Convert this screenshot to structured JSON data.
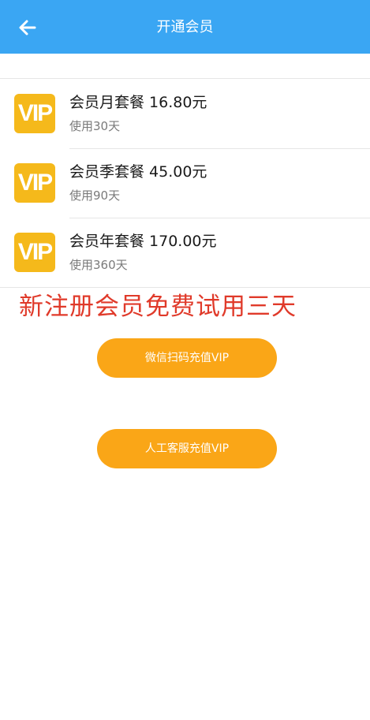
{
  "header": {
    "title": "开通会员",
    "back_icon": "arrow-left-icon"
  },
  "plans": [
    {
      "badge": "VIP",
      "title": "会员月套餐 16.80元",
      "duration": "使用30天"
    },
    {
      "badge": "VIP",
      "title": "会员季套餐 45.00元",
      "duration": "使用90天"
    },
    {
      "badge": "VIP",
      "title": "会员年套餐 170.00元",
      "duration": "使用360天"
    }
  ],
  "promo_text": "新注册会员免费试用三天",
  "buttons": {
    "wechat_label": "微信扫码充值VIP",
    "manual_label": "人工客服充值VIP"
  },
  "colors": {
    "header_bg": "#3aa6f3",
    "badge_bg": "#f5b91b",
    "button_bg": "#faa617",
    "promo_text": "#e03a2a"
  }
}
